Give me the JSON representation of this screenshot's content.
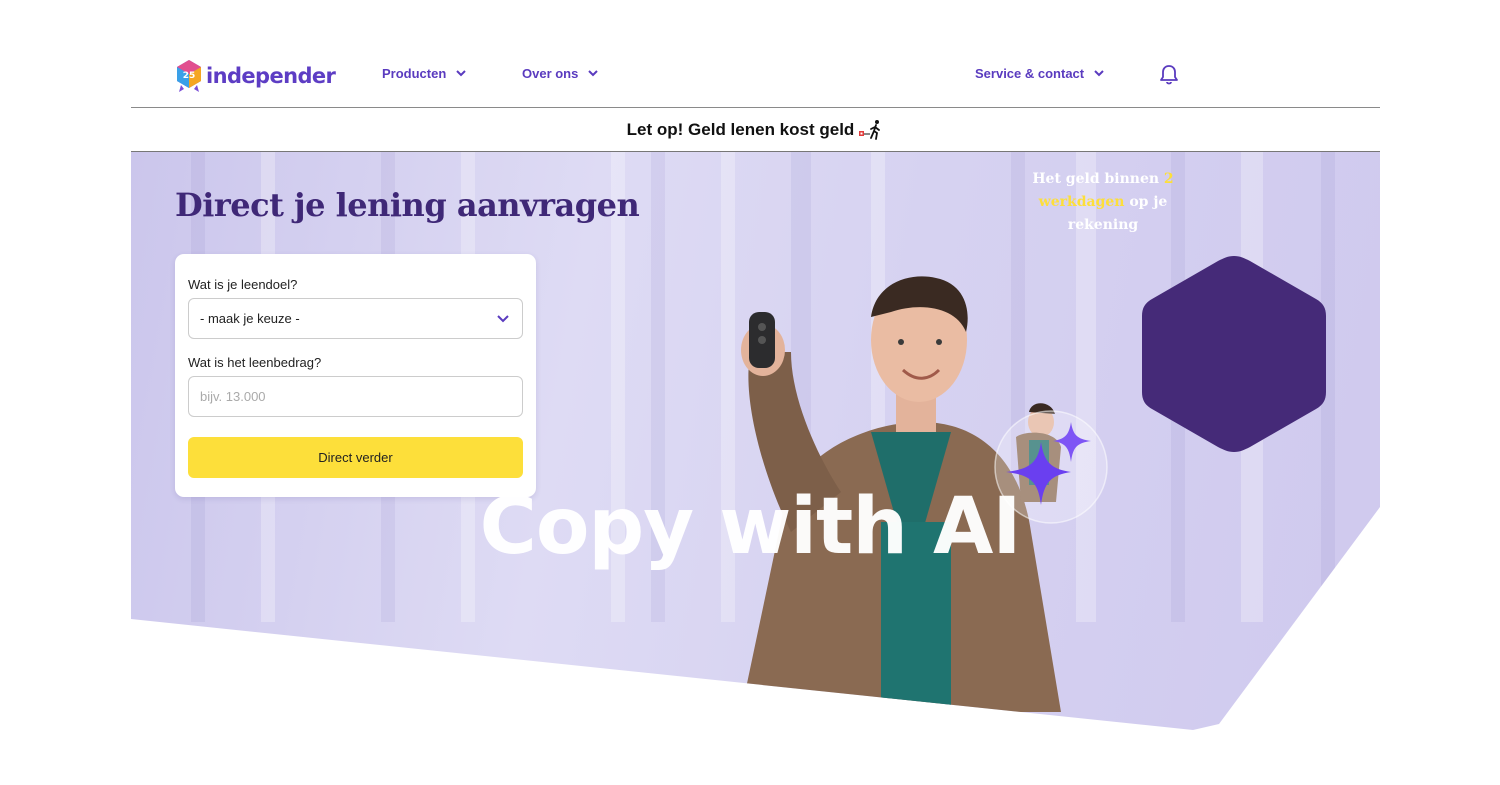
{
  "header": {
    "logo_text": "independer",
    "logo_badge": "25",
    "nav": {
      "products": "Producten",
      "about": "Over ons",
      "service": "Service & contact"
    }
  },
  "warning": {
    "text": "Let op! Geld lenen kost geld"
  },
  "hero": {
    "title": "Direct je lening aanvragen",
    "form": {
      "purpose_label": "Wat is je leendoel?",
      "purpose_value": "- maak je keuze -",
      "amount_label": "Wat is het leenbedrag?",
      "amount_placeholder": "bijv. 13.000",
      "submit_label": "Direct verder"
    },
    "badge": {
      "part1": "Het geld binnen ",
      "highlight": "2 werkdagen",
      "part2": " op je rekening"
    }
  },
  "overlay": {
    "watermark": "Copy with AI"
  },
  "colors": {
    "brand_purple": "#5d3dc4",
    "dark_purple": "#452a78",
    "accent_yellow": "#fddf3a"
  },
  "icons": [
    "logo-hexagon",
    "chevron-down-icon",
    "bell-icon",
    "warning-walking-person-icon",
    "sparkle-stars-icon"
  ]
}
